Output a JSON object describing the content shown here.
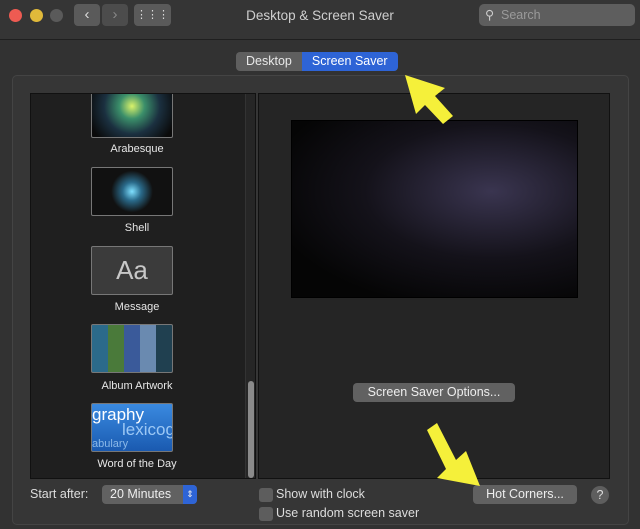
{
  "window": {
    "title": "Desktop & Screen Saver",
    "search_placeholder": "Search"
  },
  "tabs": [
    {
      "label": "Desktop",
      "selected": false
    },
    {
      "label": "Screen Saver",
      "selected": true
    }
  ],
  "screensavers": [
    {
      "label": "Arabesque"
    },
    {
      "label": "Shell"
    },
    {
      "label": "Message",
      "thumb_text": "Aa"
    },
    {
      "label": "Album Artwork"
    },
    {
      "label": "Word of the Day",
      "thumb_text": "graphy",
      "thumb_text2": "lexicog",
      "thumb_text3": "abulary"
    }
  ],
  "options_button": "Screen Saver Options...",
  "start_after": {
    "label": "Start after:",
    "value": "20 Minutes"
  },
  "show_with_clock": {
    "label": "Show with clock",
    "checked": false
  },
  "random": {
    "label": "Use random screen saver",
    "checked": false
  },
  "hot_corners": "Hot Corners...",
  "help": "?",
  "colors": {
    "accent": "#2e64d6",
    "annotation_arrow": "#f5f03a"
  }
}
